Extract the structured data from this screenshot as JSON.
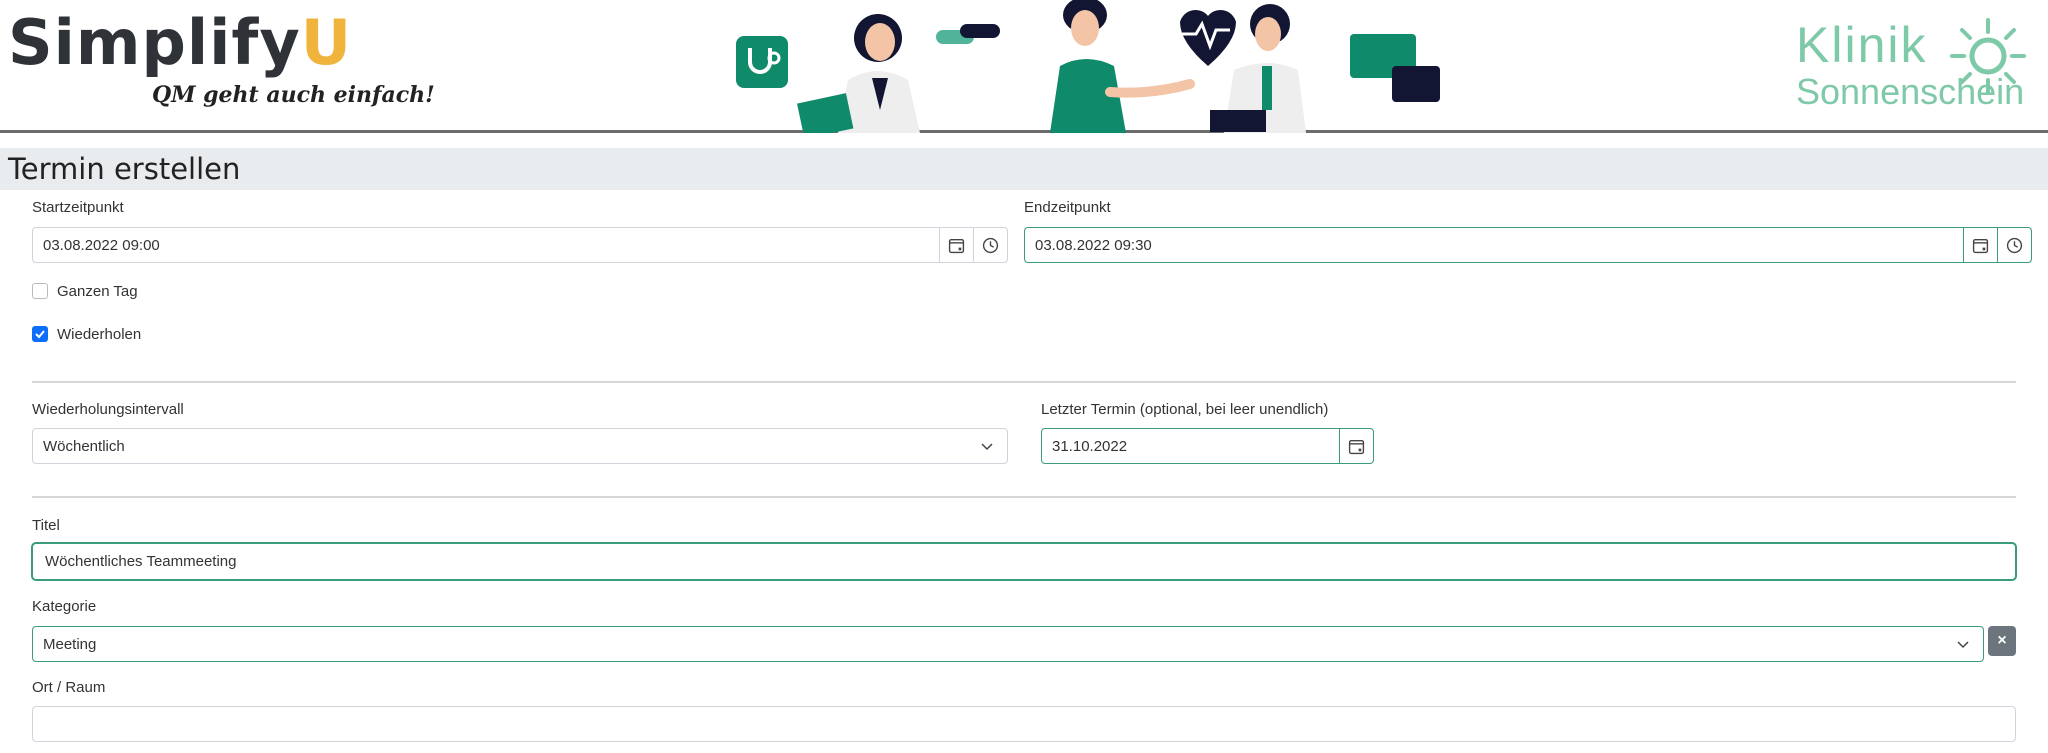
{
  "header": {
    "logo_main": "Simplify",
    "logo_u": "U",
    "logo_tagline": "QM geht auch einfach!",
    "clinic_line1": "Klinik",
    "clinic_line2": "Sonnenschein"
  },
  "page_title": "Termin erstellen",
  "start": {
    "label": "Startzeitpunkt",
    "value": "03.08.2022 09:00"
  },
  "end": {
    "label": "Endzeitpunkt",
    "value": "03.08.2022 09:30"
  },
  "all_day": {
    "label": "Ganzen Tag",
    "checked": false
  },
  "repeat": {
    "label": "Wiederholen",
    "checked": true
  },
  "interval": {
    "label": "Wiederholungsintervall",
    "value": "Wöchentlich"
  },
  "last_date": {
    "label": "Letzter Termin (optional, bei leer unendlich)",
    "value": "31.10.2022"
  },
  "title_field": {
    "label": "Titel",
    "value": "Wöchentliches Teammeeting"
  },
  "category": {
    "label": "Kategorie",
    "value": "Meeting",
    "clear": "×"
  },
  "location": {
    "label": "Ort / Raum",
    "value": ""
  },
  "colors": {
    "accent": "#3a9c78",
    "brand_teal": "#0f8a6a",
    "check_blue": "#0d6efd",
    "titlebar_bg": "#e9ecef"
  }
}
